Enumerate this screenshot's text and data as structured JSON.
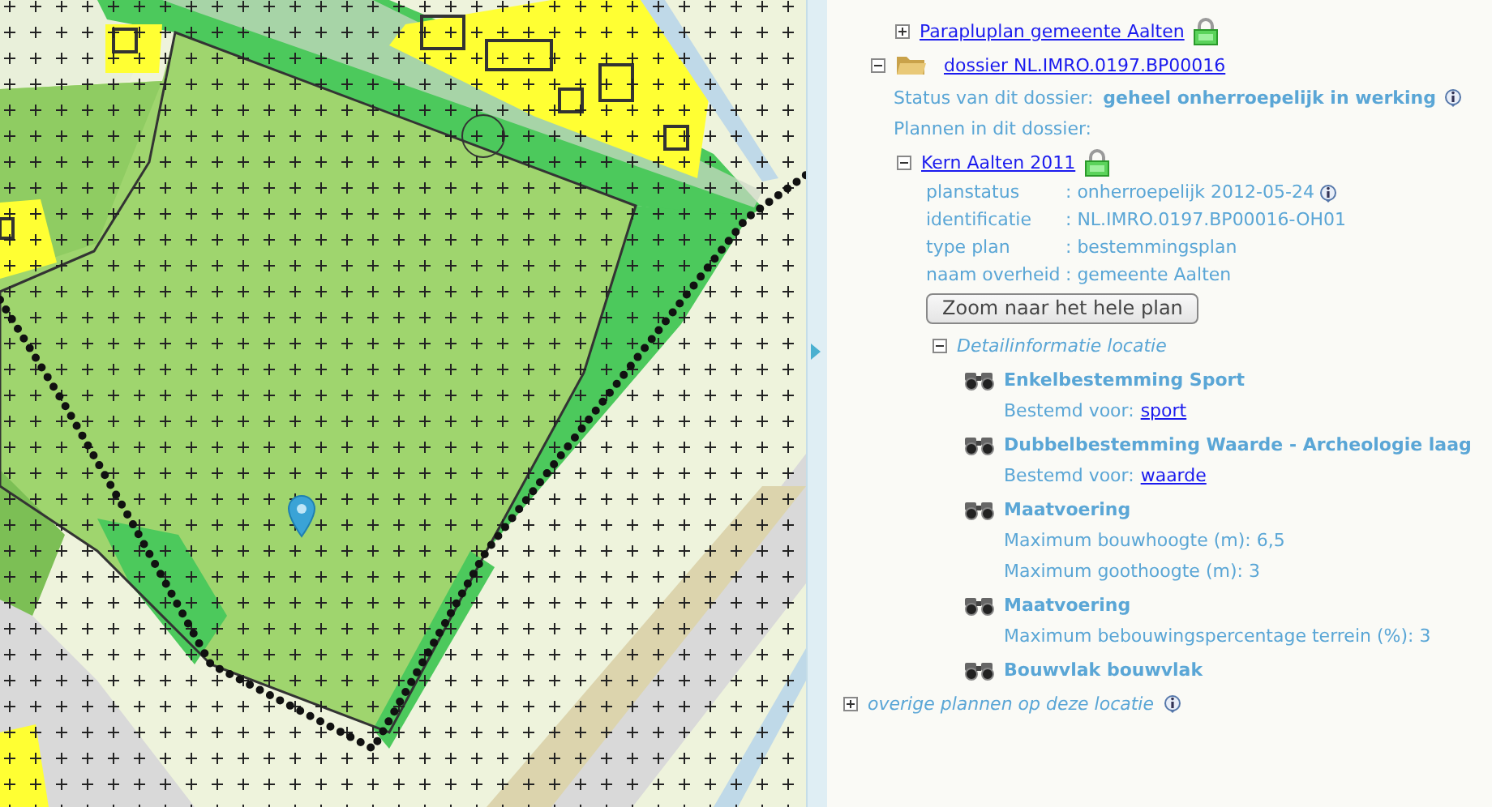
{
  "previous_plan": {
    "label": "Parapluplan gemeente Aalten",
    "expanded": false,
    "locked": true
  },
  "dossier": {
    "label": "dossier NL.IMRO.0197.BP00016",
    "expanded": true,
    "status_label": "Status van dit dossier:",
    "status": "geheel onherroepelijk in werking",
    "plans_label": "Plannen in dit dossier:",
    "plans": [
      {
        "label": "Kern Aalten 2011",
        "expanded": true,
        "locked": true,
        "properties": [
          {
            "label": "planstatus",
            "value": ": onherroepelijk 2012-05-24",
            "info": true
          },
          {
            "label": "identificatie",
            "value": ": NL.IMRO.0197.BP00016-OH01",
            "info": false
          },
          {
            "label": "type plan",
            "value": ": bestemmingsplan",
            "info": false
          },
          {
            "label": "naam overheid",
            "value": ": gemeente Aalten",
            "info": false
          }
        ],
        "zoom_button": "Zoom naar het hele plan",
        "detail": {
          "label": "Detailinformatie locatie",
          "expanded": true,
          "items": [
            {
              "title": "Enkelbestemming Sport",
              "lines": [
                {
                  "text": "Bestemd voor:",
                  "link": "sport"
                }
              ]
            },
            {
              "title": "Dubbelbestemming Waarde - Archeologie laag",
              "lines": [
                {
                  "text": "Bestemd voor:",
                  "link": "waarde"
                }
              ]
            },
            {
              "title": "Maatvoering",
              "lines": [
                {
                  "text": "Maximum bouwhoogte (m): 6,5"
                },
                {
                  "text": "Maximum goothoogte (m): 3"
                }
              ]
            },
            {
              "title": "Maatvoering",
              "lines": [
                {
                  "text": "Maximum bebouwingspercentage terrein (%): 3"
                }
              ]
            },
            {
              "title": "Bouwvlak bouwvlak"
            }
          ]
        }
      }
    ]
  },
  "other_plans": {
    "label": "overige plannen op deze locatie",
    "expanded": false,
    "info": true
  }
}
